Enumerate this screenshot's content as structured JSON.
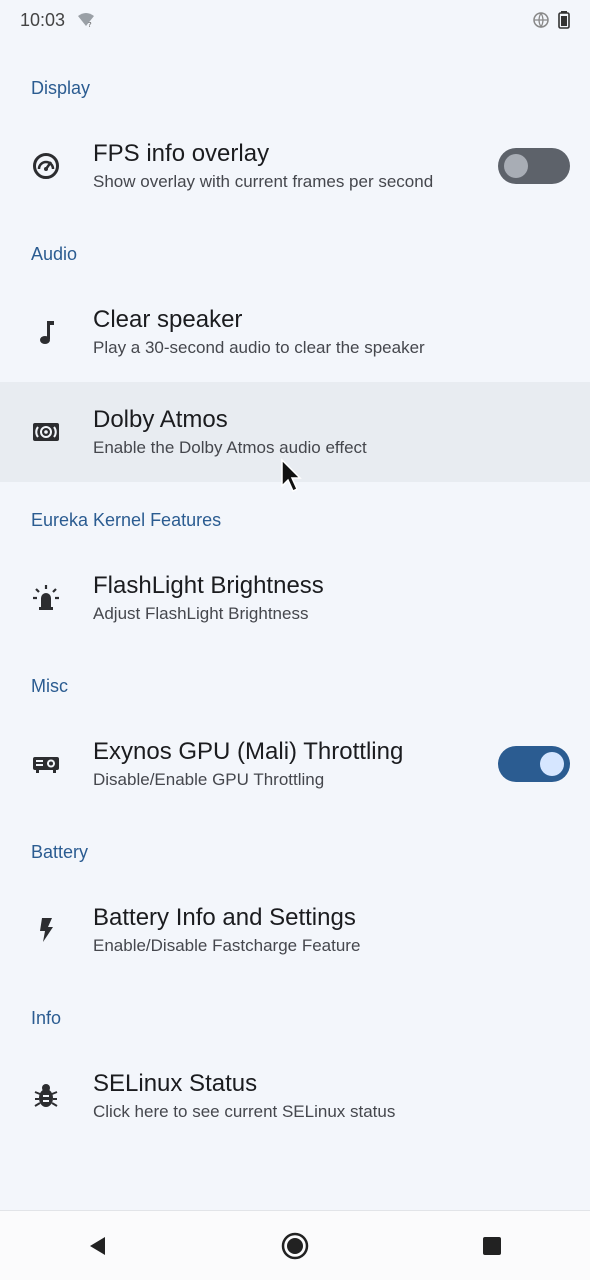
{
  "status_bar": {
    "time": "10:03"
  },
  "sections": [
    {
      "title": "Display"
    },
    {
      "title": "Audio"
    },
    {
      "title": "Eureka Kernel Features"
    },
    {
      "title": "Misc"
    },
    {
      "title": "Battery"
    },
    {
      "title": "Info"
    }
  ],
  "items": {
    "fps": {
      "title": "FPS info overlay",
      "subtitle": "Show overlay with current frames per second",
      "icon": "speedometer-icon",
      "toggle": "off"
    },
    "clear_speaker": {
      "title": "Clear speaker",
      "subtitle": "Play a 30-second audio to clear the speaker",
      "icon": "music-note-icon"
    },
    "dolby": {
      "title": "Dolby Atmos",
      "subtitle": "Enable the Dolby Atmos audio effect",
      "icon": "surround-sound-icon"
    },
    "flashlight": {
      "title": "FlashLight Brightness",
      "subtitle": "Adjust FlashLight Brightness",
      "icon": "flashlight-icon"
    },
    "gpu": {
      "title": "Exynos GPU (Mali) Throttling",
      "subtitle": "Disable/Enable GPU Throttling",
      "icon": "gpu-icon",
      "toggle": "on"
    },
    "battery": {
      "title": "Battery Info and Settings",
      "subtitle": "Enable/Disable Fastcharge Feature",
      "icon": "lightning-icon"
    },
    "selinux": {
      "title": "SELinux Status",
      "subtitle": "Click here to see current SELinux status",
      "icon": "bug-icon"
    }
  },
  "colors": {
    "accent": "#2b5c91",
    "background": "#f3f6fb",
    "highlight": "#e8ecf1"
  }
}
